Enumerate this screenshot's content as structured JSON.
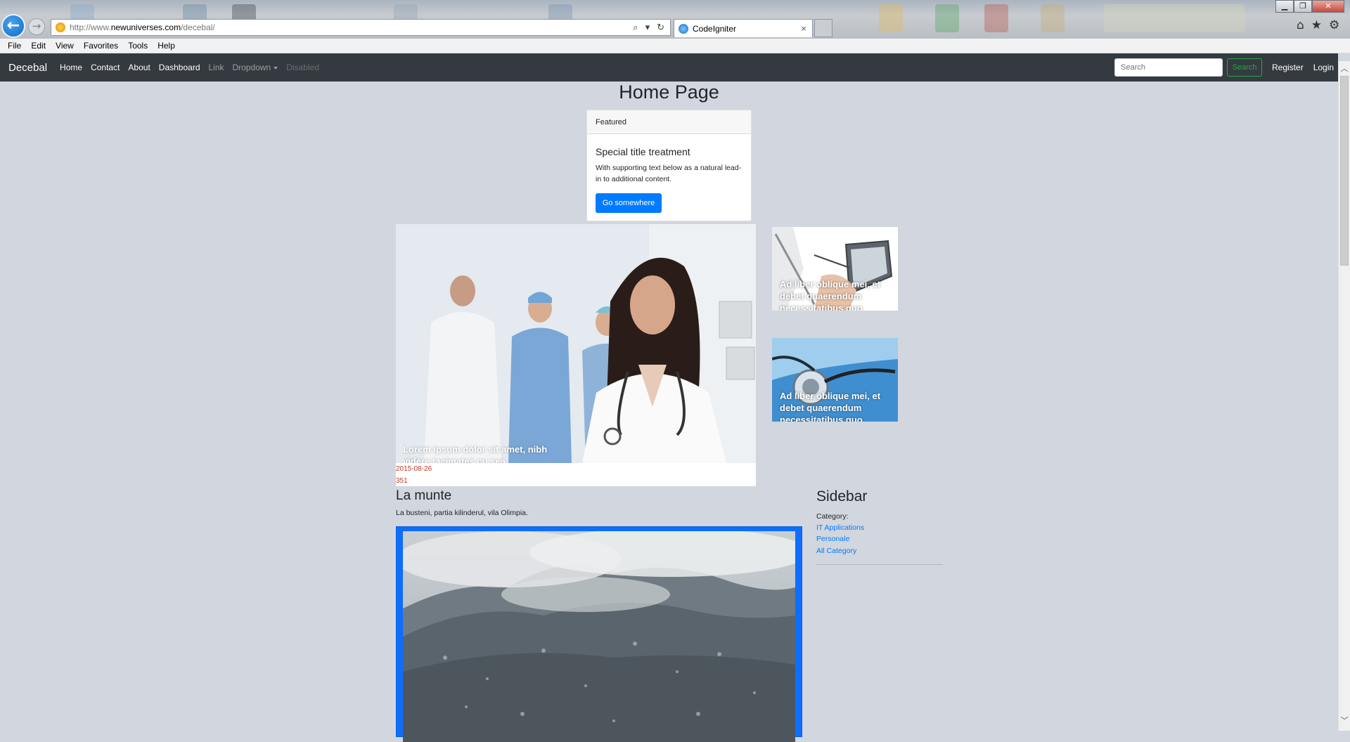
{
  "browser": {
    "url_prefix": "http://www.",
    "url_domain": "newuniverses.com",
    "url_path": "/decebal/",
    "tab_title": "CodeIgniter",
    "tab_close": "×",
    "back_glyph": "←",
    "forward_glyph": "→",
    "address_icons": [
      "search-icon",
      "dropdown-icon",
      "refresh-icon"
    ],
    "address_icon_glyphs": [
      "⌕",
      "▾",
      "↻"
    ],
    "window_controls": [
      "▁",
      "❐",
      "✕"
    ],
    "right_tools": [
      "home-icon",
      "favorites-star-icon",
      "settings-gear-icon"
    ],
    "right_tool_glyphs": [
      "⌂",
      "★",
      "⚙"
    ]
  },
  "menubar": {
    "items": [
      "File",
      "Edit",
      "View",
      "Favorites",
      "Tools",
      "Help"
    ]
  },
  "navbar": {
    "brand": "Decebal",
    "links": [
      "Home",
      "Contact",
      "About",
      "Dashboard"
    ],
    "link_muted": "Link",
    "dropdown": "Dropdown",
    "disabled": "Disabled",
    "search_placeholder": "Search",
    "search_button": "Search",
    "register": "Register",
    "login": "Login"
  },
  "main": {
    "page_title": "Home Page",
    "card": {
      "header": "Featured",
      "title": "Special title treatment",
      "text": "With supporting text below as a natural lead-in to additional content.",
      "button": "Go somewhere"
    },
    "hero": {
      "caption": "Lorem ipsum dolor sit amet, nibh videre tacimates cu sea",
      "date": "2015-08-26",
      "views": "351"
    },
    "thumbnails": [
      {
        "caption": "Ad liber oblique mei, et debet quaerendum necessitatibus quo"
      },
      {
        "caption": "Ad liber oblique mei, et debet quaerendum necessitatibus quo"
      }
    ],
    "article": {
      "title": "La munte",
      "description": "La busteni, partia kilinderul, vila Olimpia."
    }
  },
  "sidebar": {
    "title": "Sidebar",
    "category_label": "Category:",
    "categories": [
      "IT Applications",
      "Personale",
      "All Category"
    ]
  },
  "scrollbar": {
    "up": "︿",
    "down": "﹀"
  },
  "colors": {
    "page_bg": "#d2d6de",
    "navbar_bg": "#343a40",
    "primary": "#007bff",
    "success": "#28a745",
    "meta_red": "#c0392b"
  }
}
